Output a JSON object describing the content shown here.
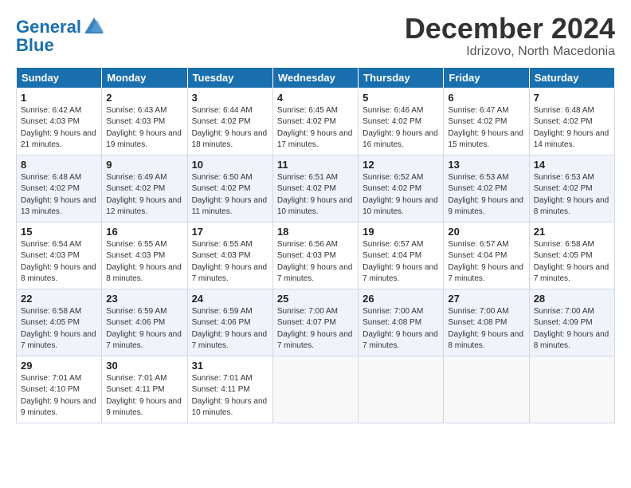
{
  "header": {
    "logo_general": "General",
    "logo_blue": "Blue",
    "month_title": "December 2024",
    "location": "Idrizovo, North Macedonia"
  },
  "weekdays": [
    "Sunday",
    "Monday",
    "Tuesday",
    "Wednesday",
    "Thursday",
    "Friday",
    "Saturday"
  ],
  "weeks": [
    [
      {
        "day": "1",
        "sunrise": "6:42 AM",
        "sunset": "4:03 PM",
        "daylight": "9 hours and 21 minutes."
      },
      {
        "day": "2",
        "sunrise": "6:43 AM",
        "sunset": "4:03 PM",
        "daylight": "9 hours and 19 minutes."
      },
      {
        "day": "3",
        "sunrise": "6:44 AM",
        "sunset": "4:02 PM",
        "daylight": "9 hours and 18 minutes."
      },
      {
        "day": "4",
        "sunrise": "6:45 AM",
        "sunset": "4:02 PM",
        "daylight": "9 hours and 17 minutes."
      },
      {
        "day": "5",
        "sunrise": "6:46 AM",
        "sunset": "4:02 PM",
        "daylight": "9 hours and 16 minutes."
      },
      {
        "day": "6",
        "sunrise": "6:47 AM",
        "sunset": "4:02 PM",
        "daylight": "9 hours and 15 minutes."
      },
      {
        "day": "7",
        "sunrise": "6:48 AM",
        "sunset": "4:02 PM",
        "daylight": "9 hours and 14 minutes."
      }
    ],
    [
      {
        "day": "8",
        "sunrise": "6:48 AM",
        "sunset": "4:02 PM",
        "daylight": "9 hours and 13 minutes."
      },
      {
        "day": "9",
        "sunrise": "6:49 AM",
        "sunset": "4:02 PM",
        "daylight": "9 hours and 12 minutes."
      },
      {
        "day": "10",
        "sunrise": "6:50 AM",
        "sunset": "4:02 PM",
        "daylight": "9 hours and 11 minutes."
      },
      {
        "day": "11",
        "sunrise": "6:51 AM",
        "sunset": "4:02 PM",
        "daylight": "9 hours and 10 minutes."
      },
      {
        "day": "12",
        "sunrise": "6:52 AM",
        "sunset": "4:02 PM",
        "daylight": "9 hours and 10 minutes."
      },
      {
        "day": "13",
        "sunrise": "6:53 AM",
        "sunset": "4:02 PM",
        "daylight": "9 hours and 9 minutes."
      },
      {
        "day": "14",
        "sunrise": "6:53 AM",
        "sunset": "4:02 PM",
        "daylight": "9 hours and 8 minutes."
      }
    ],
    [
      {
        "day": "15",
        "sunrise": "6:54 AM",
        "sunset": "4:03 PM",
        "daylight": "9 hours and 8 minutes."
      },
      {
        "day": "16",
        "sunrise": "6:55 AM",
        "sunset": "4:03 PM",
        "daylight": "9 hours and 8 minutes."
      },
      {
        "day": "17",
        "sunrise": "6:55 AM",
        "sunset": "4:03 PM",
        "daylight": "9 hours and 7 minutes."
      },
      {
        "day": "18",
        "sunrise": "6:56 AM",
        "sunset": "4:03 PM",
        "daylight": "9 hours and 7 minutes."
      },
      {
        "day": "19",
        "sunrise": "6:57 AM",
        "sunset": "4:04 PM",
        "daylight": "9 hours and 7 minutes."
      },
      {
        "day": "20",
        "sunrise": "6:57 AM",
        "sunset": "4:04 PM",
        "daylight": "9 hours and 7 minutes."
      },
      {
        "day": "21",
        "sunrise": "6:58 AM",
        "sunset": "4:05 PM",
        "daylight": "9 hours and 7 minutes."
      }
    ],
    [
      {
        "day": "22",
        "sunrise": "6:58 AM",
        "sunset": "4:05 PM",
        "daylight": "9 hours and 7 minutes."
      },
      {
        "day": "23",
        "sunrise": "6:59 AM",
        "sunset": "4:06 PM",
        "daylight": "9 hours and 7 minutes."
      },
      {
        "day": "24",
        "sunrise": "6:59 AM",
        "sunset": "4:06 PM",
        "daylight": "9 hours and 7 minutes."
      },
      {
        "day": "25",
        "sunrise": "7:00 AM",
        "sunset": "4:07 PM",
        "daylight": "9 hours and 7 minutes."
      },
      {
        "day": "26",
        "sunrise": "7:00 AM",
        "sunset": "4:08 PM",
        "daylight": "9 hours and 7 minutes."
      },
      {
        "day": "27",
        "sunrise": "7:00 AM",
        "sunset": "4:08 PM",
        "daylight": "9 hours and 8 minutes."
      },
      {
        "day": "28",
        "sunrise": "7:00 AM",
        "sunset": "4:09 PM",
        "daylight": "9 hours and 8 minutes."
      }
    ],
    [
      {
        "day": "29",
        "sunrise": "7:01 AM",
        "sunset": "4:10 PM",
        "daylight": "9 hours and 9 minutes."
      },
      {
        "day": "30",
        "sunrise": "7:01 AM",
        "sunset": "4:11 PM",
        "daylight": "9 hours and 9 minutes."
      },
      {
        "day": "31",
        "sunrise": "7:01 AM",
        "sunset": "4:11 PM",
        "daylight": "9 hours and 10 minutes."
      },
      null,
      null,
      null,
      null
    ]
  ]
}
